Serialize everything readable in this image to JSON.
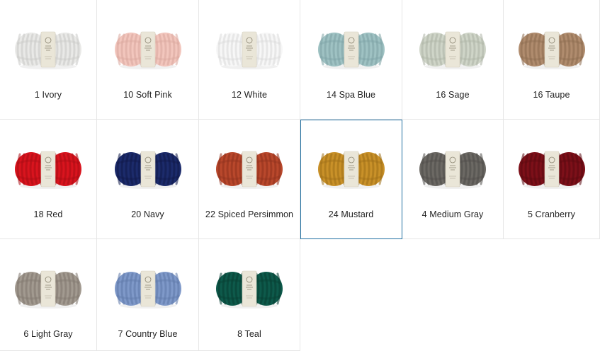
{
  "swatches": [
    {
      "label": "1 Ivory",
      "color": "#e9e9e7",
      "shade": "#c9c9c6"
    },
    {
      "label": "10 Soft Pink",
      "color": "#f2c6bd",
      "shade": "#d9a79e"
    },
    {
      "label": "12 White",
      "color": "#f7f7f7",
      "shade": "#dadada"
    },
    {
      "label": "14 Spa Blue",
      "color": "#9fc2c3",
      "shade": "#7ea3a4"
    },
    {
      "label": "16 Sage",
      "color": "#cfd5c8",
      "shade": "#adb3a6"
    },
    {
      "label": "16 Taupe",
      "color": "#b08c6e",
      "shade": "#8d6c51"
    },
    {
      "label": "18 Red",
      "color": "#d9141e",
      "shade": "#a80c14"
    },
    {
      "label": "20 Navy",
      "color": "#1c2b6b",
      "shade": "#111a48"
    },
    {
      "label": "22 Spiced Persimmon",
      "color": "#b9482c",
      "shade": "#8f321d"
    },
    {
      "label": "24 Mustard",
      "color": "#c99129",
      "shade": "#9d6f18"
    },
    {
      "label": "4 Medium Gray",
      "color": "#6c6964",
      "shade": "#4f4c48"
    },
    {
      "label": "5 Cranberry",
      "color": "#7d1019",
      "shade": "#5a0910"
    },
    {
      "label": "6 Light Gray",
      "color": "#a29a90",
      "shade": "#7f776e"
    },
    {
      "label": "7 Country Blue",
      "color": "#7f99c9",
      "shade": "#5f78a7"
    },
    {
      "label": "8 Teal",
      "color": "#0e5a4b",
      "shade": "#073e33"
    }
  ],
  "selected_label": "24 Mustard",
  "band": {
    "color": "#eae6d8",
    "text_color": "#8a8470"
  }
}
